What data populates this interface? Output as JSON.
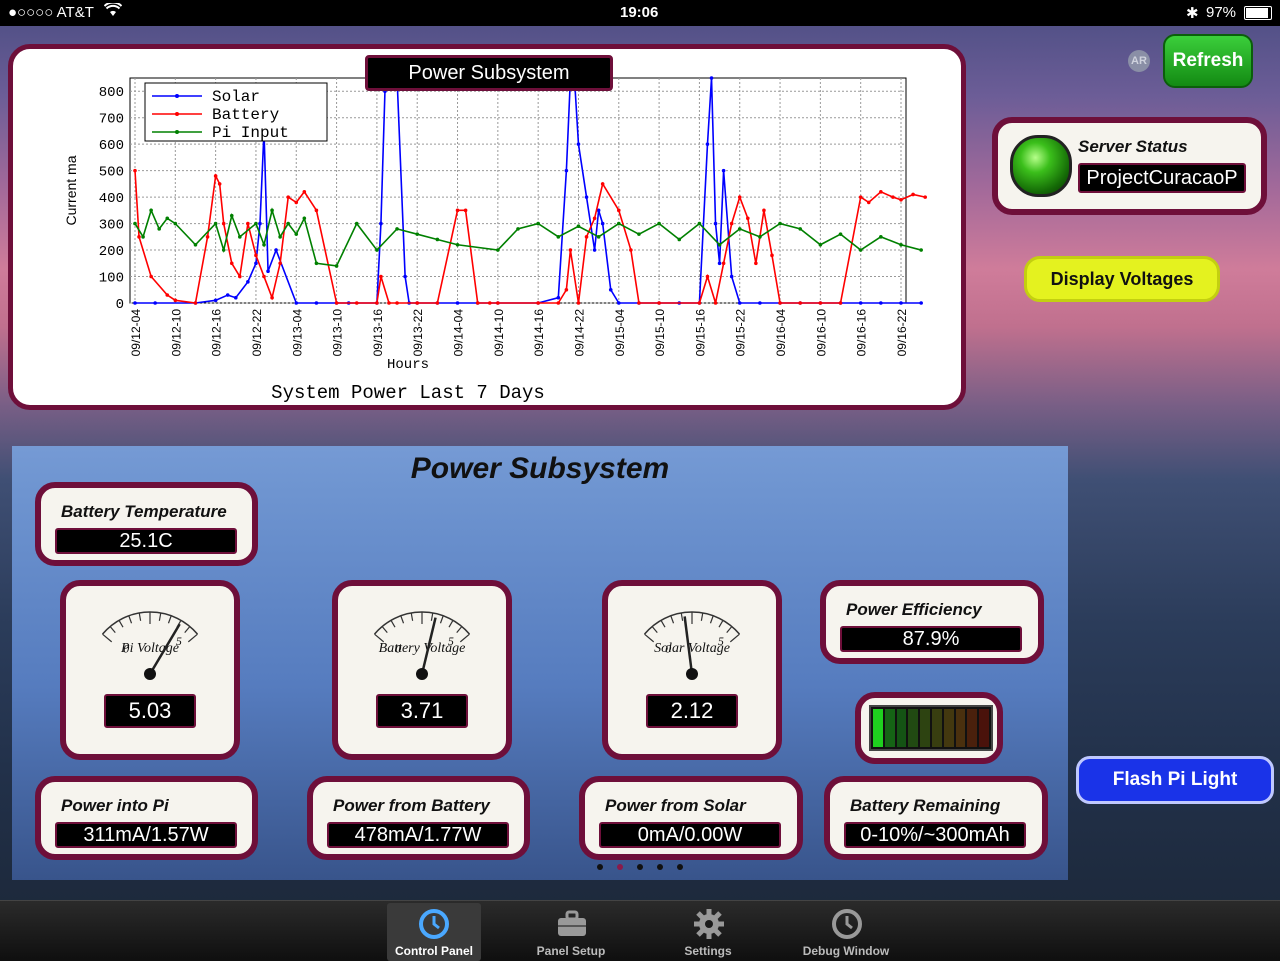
{
  "status_bar": {
    "carrier": "●○○○○ AT&T",
    "time": "19:06",
    "battery": "97%"
  },
  "header": {
    "ar_label": "AR",
    "refresh_label": "Refresh"
  },
  "server_status": {
    "label": "Server Status",
    "value": "ProjectCuracaoP"
  },
  "display_voltages_label": "Display Voltages",
  "flash_pi_label": "Flash Pi Light",
  "chart_title_box": "Power Subsystem",
  "panel_title": "Power Subsystem",
  "cards": {
    "battery_temperature": {
      "label": "Battery Temperature",
      "value": "25.1C"
    },
    "power_efficiency": {
      "label": "Power Efficiency",
      "value": "87.9%"
    },
    "power_into_pi": {
      "label": "Power into Pi",
      "value": "311mA/1.57W"
    },
    "power_from_battery": {
      "label": "Power from Battery",
      "value": "478mA/1.77W"
    },
    "power_from_solar": {
      "label": "Power from Solar",
      "value": "0mA/0.00W"
    },
    "battery_remaining": {
      "label": "Battery Remaining",
      "value": "0-10%/~300mAh"
    }
  },
  "gauges": {
    "pi_voltage": {
      "name": "Pi Voltage",
      "value": "5.03",
      "reading": 5.03,
      "min": "0",
      "max": "5"
    },
    "battery_voltage": {
      "name": "Battery Voltage",
      "value": "3.71",
      "reading": 3.71,
      "min": "0",
      "max": "5"
    },
    "solar_voltage": {
      "name": "Solar Voltage",
      "value": "2.12",
      "reading": 2.12,
      "min": "0",
      "max": "5"
    }
  },
  "battery_bar_level": 0.1,
  "page_dots": {
    "count": 5,
    "active": 1
  },
  "tabs": [
    {
      "label": "Control Panel",
      "icon": "clock-icon",
      "active": true
    },
    {
      "label": "Panel Setup",
      "icon": "toolbox-icon",
      "active": false
    },
    {
      "label": "Settings",
      "icon": "gear-icon",
      "active": false
    },
    {
      "label": "Debug Window",
      "icon": "clock-icon",
      "active": false
    }
  ],
  "colors": {
    "accent": "#6e0f3a",
    "refresh": "#1e9e1e",
    "voltages": "#e4f21f",
    "flash": "#1a33e8",
    "solar": "#0000ff",
    "battery": "#ff0000",
    "pi_input": "#008000"
  },
  "chart_data": {
    "type": "line",
    "title": "System Power Last 7 Days",
    "xlabel": "Hours",
    "ylabel": "Current ma",
    "ylim": [
      0,
      850
    ],
    "yticks": [
      0,
      100,
      200,
      300,
      400,
      500,
      600,
      700,
      800
    ],
    "xticks": [
      "09/12-04",
      "09/12-10",
      "09/12-16",
      "09/12-22",
      "09/13-04",
      "09/13-10",
      "09/13-16",
      "09/13-22",
      "09/14-04",
      "09/14-10",
      "09/14-16",
      "09/14-22",
      "09/15-04",
      "09/15-10",
      "09/15-16",
      "09/15-22",
      "09/16-04",
      "09/16-10",
      "09/16-16",
      "09/16-22"
    ],
    "legend": "top-left",
    "series": [
      {
        "name": "Solar",
        "color": "#0000ff",
        "x": [
          0,
          0.5,
          1.5,
          2.0,
          2.3,
          2.5,
          2.8,
          3.0,
          3.1,
          3.2,
          3.3,
          3.5,
          4.0,
          4.5,
          5.0,
          5.3,
          6.0,
          6.1,
          6.2,
          6.3,
          6.5,
          6.7,
          6.8,
          7.0,
          7.5,
          8.0,
          8.5,
          9.0,
          10.0,
          10.5,
          10.7,
          10.8,
          10.9,
          11.0,
          11.2,
          11.4,
          11.5,
          11.6,
          11.8,
          12.0,
          12.5,
          13.0,
          13.5,
          14.0,
          14.2,
          14.3,
          14.4,
          14.5,
          14.6,
          14.8,
          15.0,
          15.5,
          16.0,
          16.5,
          17.0,
          17.5,
          18.0,
          18.5,
          19.0,
          19.5
        ],
        "y": [
          0,
          0,
          0,
          10,
          30,
          20,
          80,
          150,
          300,
          650,
          120,
          200,
          0,
          0,
          0,
          0,
          0,
          300,
          800,
          900,
          850,
          100,
          0,
          0,
          0,
          0,
          0,
          0,
          0,
          20,
          500,
          850,
          900,
          600,
          400,
          200,
          350,
          300,
          50,
          0,
          0,
          0,
          0,
          0,
          600,
          900,
          300,
          150,
          500,
          100,
          0,
          0,
          0,
          0,
          0,
          0,
          0,
          0,
          0,
          0
        ]
      },
      {
        "name": "Battery",
        "color": "#ff0000",
        "x": [
          0,
          0.1,
          0.4,
          0.8,
          1.0,
          1.5,
          1.8,
          2.0,
          2.1,
          2.2,
          2.4,
          2.6,
          2.8,
          3.0,
          3.2,
          3.4,
          3.6,
          3.8,
          4.0,
          4.2,
          4.5,
          5.0,
          5.5,
          6.0,
          6.1,
          6.3,
          6.5,
          7.0,
          7.5,
          8.0,
          8.2,
          8.5,
          8.8,
          9.0,
          10.0,
          10.5,
          10.7,
          10.8,
          11.0,
          11.2,
          11.4,
          11.6,
          12.0,
          12.3,
          12.5,
          13.0,
          14.0,
          14.2,
          14.4,
          14.6,
          14.8,
          15.0,
          15.2,
          15.4,
          15.6,
          15.8,
          16.0,
          16.5,
          17.0,
          17.5,
          18.0,
          18.2,
          18.5,
          18.8,
          19.0,
          19.3,
          19.6
        ],
        "y": [
          500,
          250,
          100,
          30,
          10,
          0,
          250,
          480,
          450,
          300,
          150,
          100,
          300,
          180,
          100,
          20,
          150,
          400,
          380,
          420,
          350,
          0,
          0,
          0,
          100,
          0,
          0,
          0,
          0,
          350,
          350,
          0,
          0,
          0,
          0,
          0,
          50,
          200,
          0,
          250,
          320,
          450,
          350,
          200,
          0,
          0,
          0,
          100,
          0,
          150,
          300,
          400,
          320,
          150,
          350,
          180,
          0,
          0,
          0,
          0,
          400,
          380,
          420,
          400,
          390,
          410,
          400
        ]
      },
      {
        "name": "Pi Input",
        "color": "#008000",
        "x": [
          0,
          0.2,
          0.4,
          0.6,
          0.8,
          1.0,
          1.5,
          2.0,
          2.2,
          2.4,
          2.6,
          3.0,
          3.2,
          3.4,
          3.6,
          3.8,
          4.0,
          4.2,
          4.5,
          5.0,
          5.5,
          6.0,
          6.5,
          7.0,
          7.5,
          8.0,
          9.0,
          9.5,
          10.0,
          10.5,
          11.0,
          11.5,
          12.0,
          12.5,
          13.0,
          13.5,
          14.0,
          14.5,
          15.0,
          15.5,
          16.0,
          16.5,
          17.0,
          17.5,
          18.0,
          18.5,
          19.0,
          19.5
        ],
        "y": [
          300,
          250,
          350,
          280,
          320,
          300,
          220,
          300,
          200,
          330,
          250,
          300,
          220,
          350,
          250,
          300,
          260,
          320,
          150,
          140,
          300,
          200,
          280,
          260,
          240,
          220,
          200,
          280,
          300,
          250,
          290,
          250,
          300,
          260,
          300,
          240,
          300,
          220,
          280,
          250,
          300,
          280,
          220,
          260,
          200,
          250,
          220,
          200
        ]
      }
    ]
  }
}
